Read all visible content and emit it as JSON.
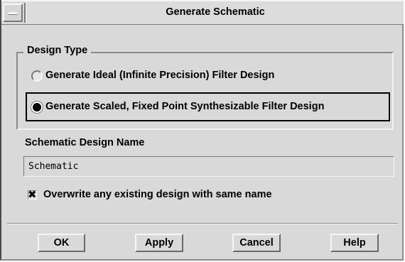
{
  "window": {
    "title": "Generate Schematic",
    "menu_icon": "window-menu-icon"
  },
  "design_type": {
    "label": "Design Type",
    "options": [
      {
        "label": "Generate Ideal (Infinite Precision) Filter Design",
        "selected": false
      },
      {
        "label": "Generate Scaled, Fixed Point Synthesizable Filter Design",
        "selected": true
      }
    ]
  },
  "schematic_name": {
    "label": "Schematic Design Name",
    "value": "Schematic"
  },
  "overwrite": {
    "label": "Overwrite any existing design with same name",
    "checked": true,
    "mark": "✖"
  },
  "buttons": {
    "ok": "OK",
    "apply": "Apply",
    "cancel": "Cancel",
    "help": "Help"
  }
}
